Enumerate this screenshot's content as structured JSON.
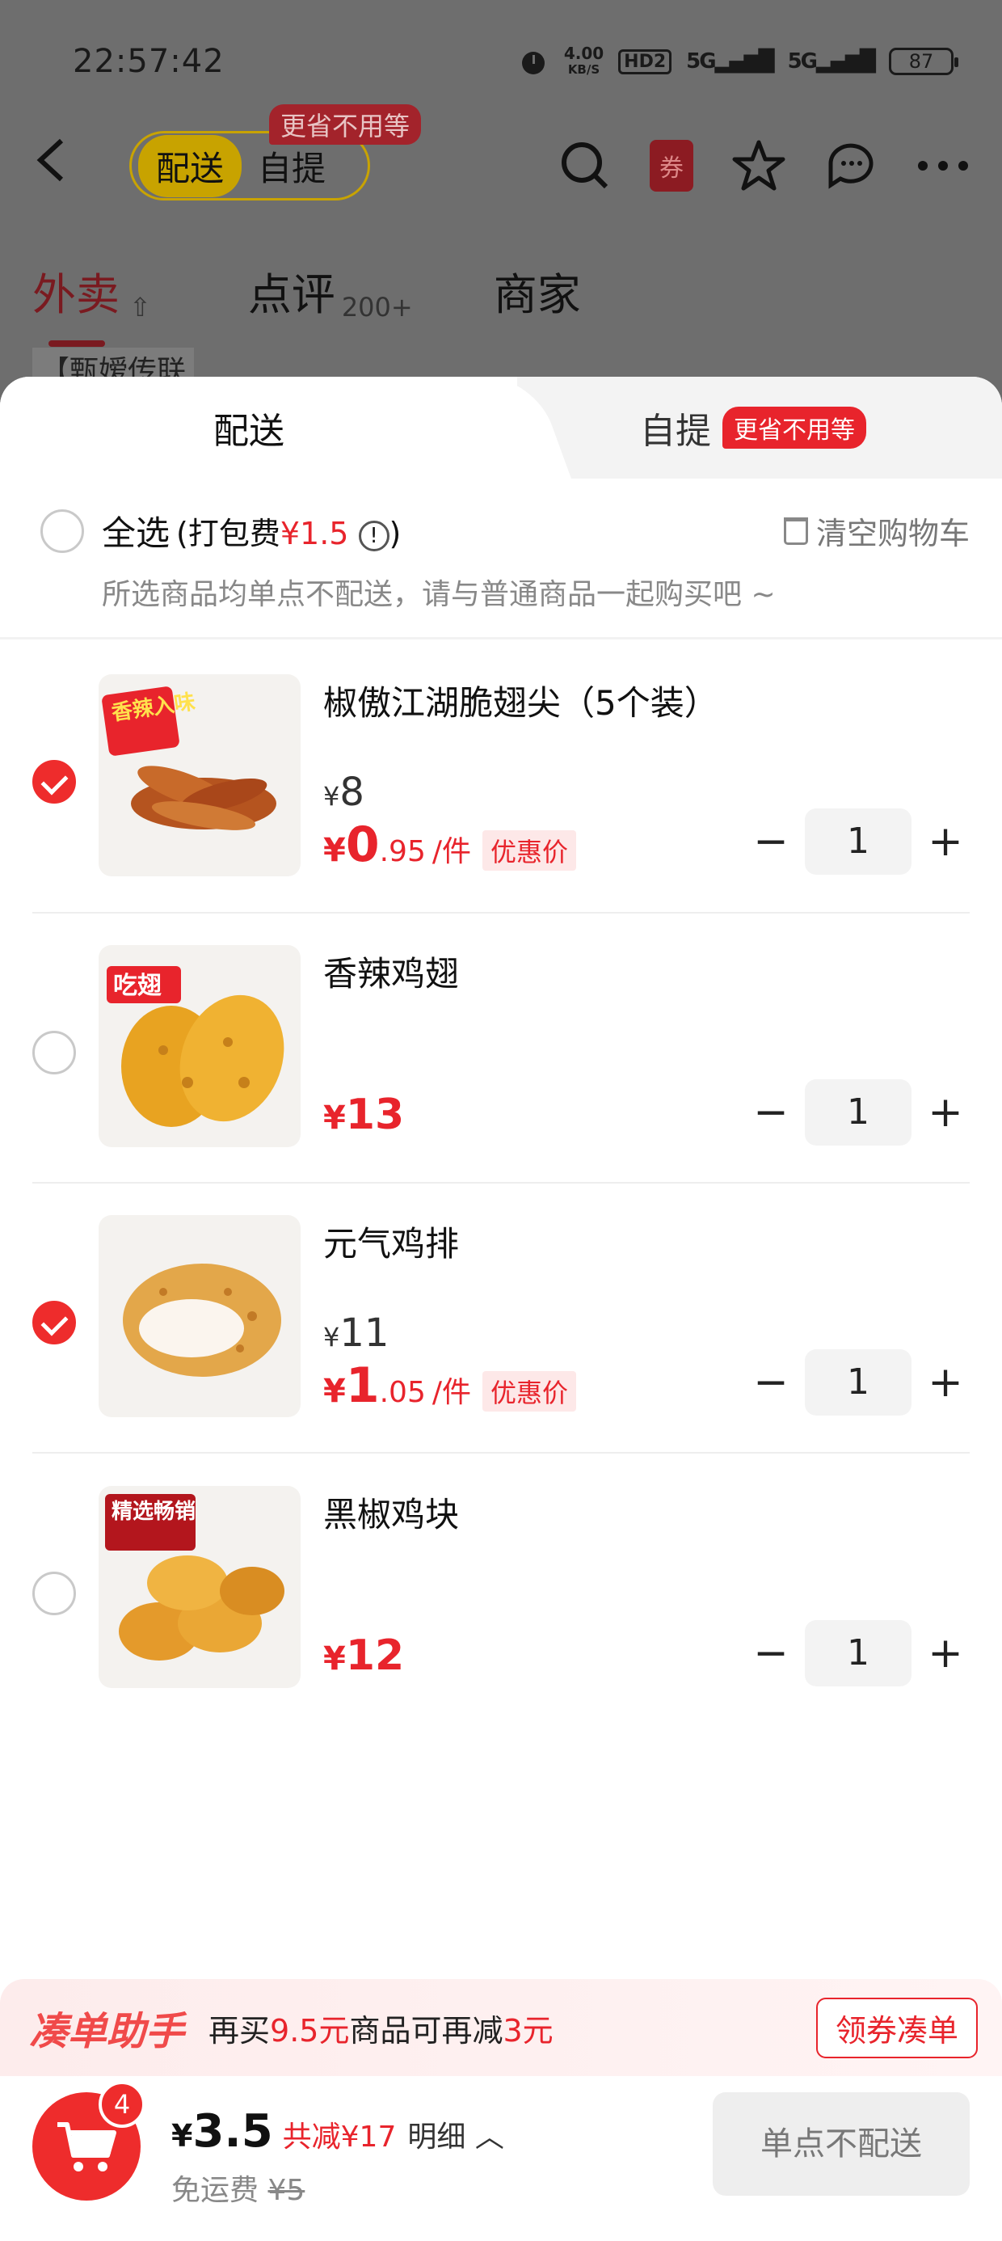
{
  "status_bar": {
    "time": "22:57:42",
    "speed_value": "4.00",
    "speed_unit": "KB/S",
    "hd": "HD2",
    "sig1": "5G",
    "sig2": "5G",
    "battery": "87"
  },
  "nav": {
    "mode_on": "配送",
    "mode_off": "自提",
    "mode_tip": "更省不用等",
    "coupon": "券"
  },
  "store_tabs": [
    {
      "label": "外卖"
    },
    {
      "label": "点评",
      "count": "200+"
    },
    {
      "label": "商家"
    }
  ],
  "behind_text": "【甄嫒传联",
  "sheet": {
    "tab_delivery": "配送",
    "tab_pickup": "自提",
    "tab_pickup_badge": "更省不用等",
    "select_all": "全选",
    "packing_prefix": "(打包费",
    "packing_fee": "¥1.5",
    "packing_suffix": ")",
    "info_icon": "!",
    "clear_cart": "清空购物车",
    "hint": "所选商品均单点不配送，请与普通商品一起购买吧 ~"
  },
  "items": [
    {
      "name": "椒傲江湖脆翅尖（5个装）",
      "selected": true,
      "orig_price_symbol": "¥",
      "orig_price": "8",
      "price_symbol": "¥",
      "price_int": "0",
      "price_dec": ".95",
      "unit": "/件",
      "tag": "优惠价",
      "qty": "1",
      "badge": "香辣入味"
    },
    {
      "name": "香辣鸡翅",
      "selected": false,
      "price_symbol": "¥",
      "price_int": "13",
      "qty": "1",
      "badge": "吃翅"
    },
    {
      "name": "元气鸡排",
      "selected": true,
      "orig_price_symbol": "¥",
      "orig_price": "11",
      "price_symbol": "¥",
      "price_int": "1",
      "price_dec": ".05",
      "unit": "/件",
      "tag": "优惠价",
      "qty": "1"
    },
    {
      "name": "黑椒鸡块",
      "selected": false,
      "price_symbol": "¥",
      "price_int": "12",
      "qty": "1",
      "badge": "精选畅销"
    }
  ],
  "stepper": {
    "minus": "−",
    "plus": "+"
  },
  "helper": {
    "brand": "凑单助手",
    "msg_a": "再买",
    "msg_amount": "9.5元",
    "msg_b": "商品可再减",
    "msg_discount": "3元",
    "button": "领券凑单"
  },
  "checkout": {
    "cart_count": "4",
    "total_symbol": "¥",
    "total": "3.5",
    "savings": "共减¥17",
    "detail": "明细",
    "detail_icon": "chevron-up-icon",
    "shipping_label": "免运费",
    "shipping_old": "¥5",
    "cta": "单点不配送"
  },
  "colors": {
    "accent": "#e8242c",
    "check": "#ee2c2c",
    "helper_brand": "#f04a4a"
  }
}
